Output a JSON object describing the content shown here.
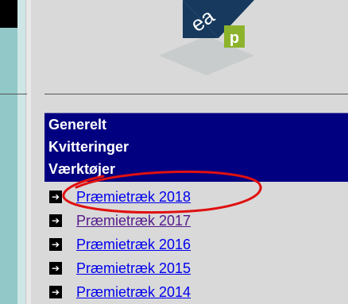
{
  "logo": {
    "letters": "ea",
    "badge": "p"
  },
  "nav": {
    "items": [
      {
        "label": "Generelt"
      },
      {
        "label": "Kvitteringer"
      },
      {
        "label": "Værktøjer"
      }
    ]
  },
  "links": [
    {
      "label": "Præmietræk 2018",
      "visited": false
    },
    {
      "label": "Præmietræk 2017",
      "visited": true
    },
    {
      "label": "Præmietræk 2016",
      "visited": false
    },
    {
      "label": "Præmietræk 2015",
      "visited": false
    },
    {
      "label": "Præmietræk 2014",
      "visited": false
    }
  ],
  "icons": {
    "link_bullet": "arrow-right-icon"
  },
  "colors": {
    "nav_background": "#000080",
    "link": "#0000ee",
    "link_visited": "#551a8b",
    "annotation": "#e01010",
    "logo_dark": "#17395e",
    "logo_green": "#8db32c"
  }
}
